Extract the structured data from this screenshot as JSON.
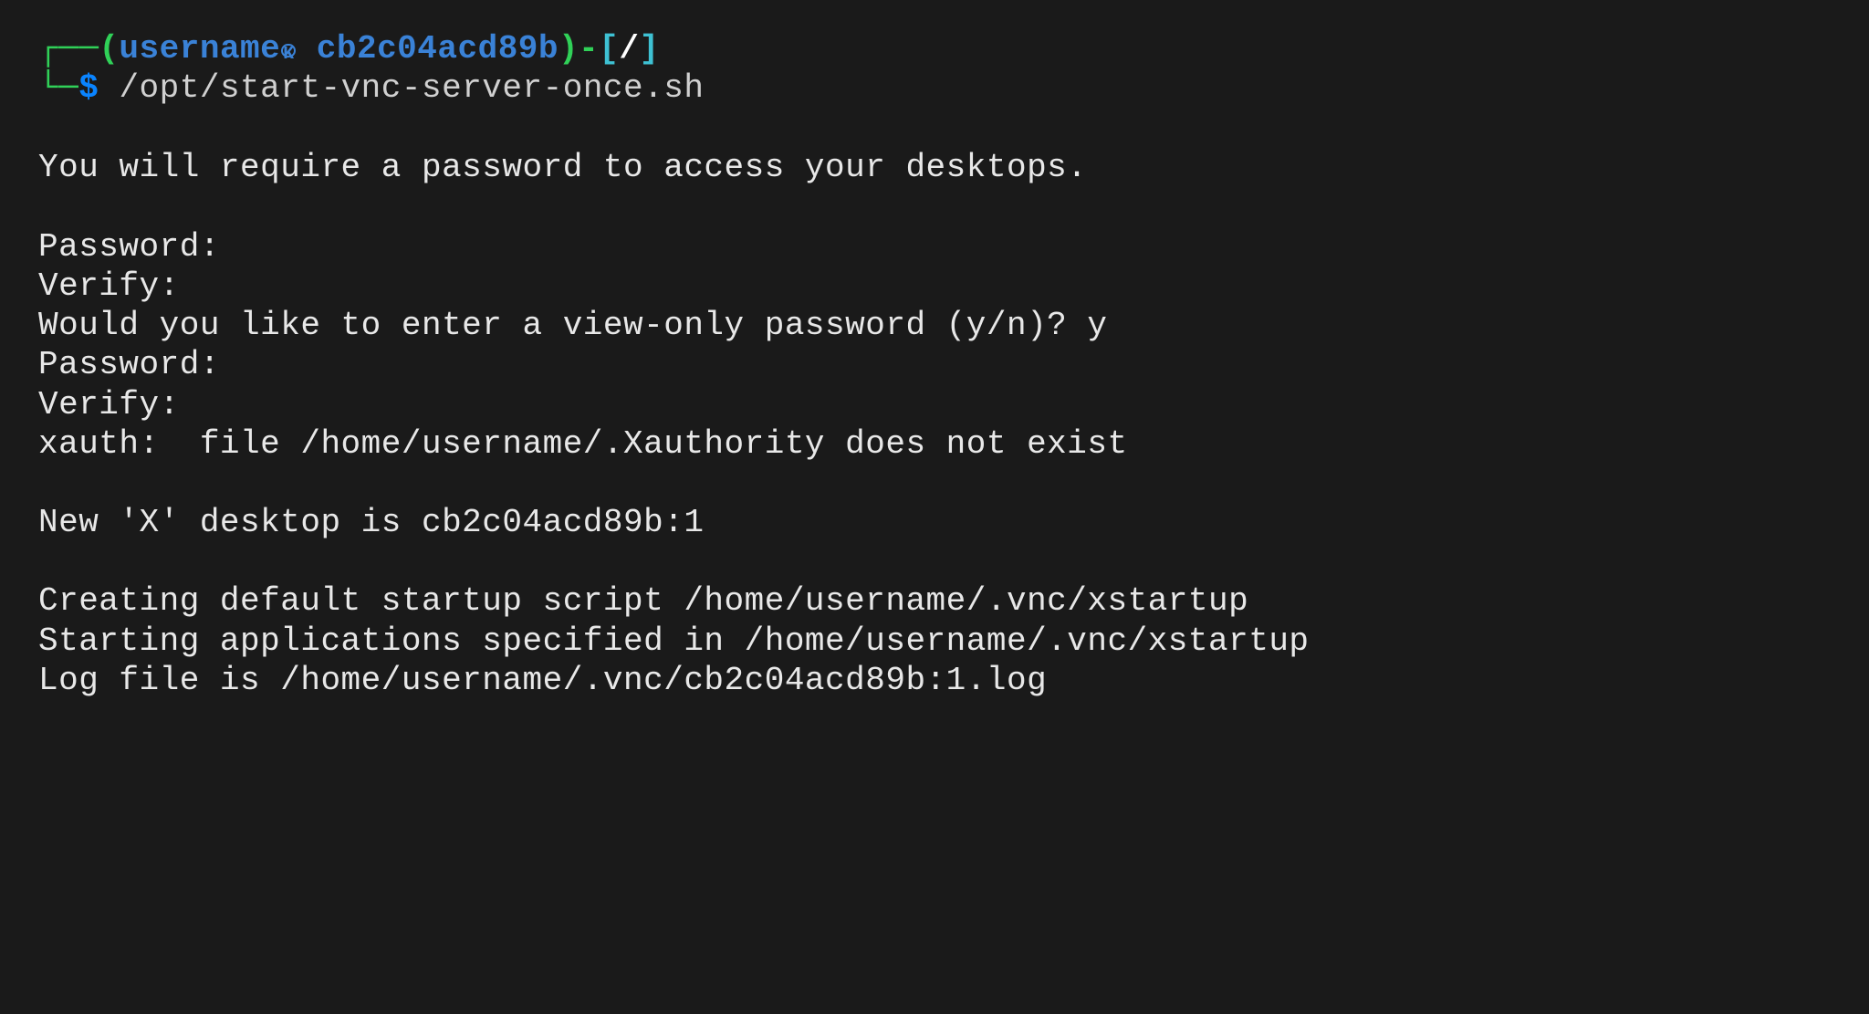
{
  "prompt": {
    "corner_tl": "┌──",
    "paren_open": "(",
    "username": "username",
    "host": "cb2c04acd89b",
    "paren_close": ")",
    "dash": "-",
    "bracket_open": "[",
    "cwd": "/",
    "bracket_close": "]",
    "corner_bl": "└─",
    "dollar": "$",
    "command": "/opt/start-vnc-server-once.sh"
  },
  "output": {
    "l0": "",
    "l1": "You will require a password to access your desktops.",
    "l2": "",
    "l3": "Password:",
    "l4": "Verify:",
    "l5": "Would you like to enter a view-only password (y/n)? y",
    "l6": "Password:",
    "l7": "Verify:",
    "l8": "xauth:  file /home/username/.Xauthority does not exist",
    "l9": "",
    "l10": "New 'X' desktop is cb2c04acd89b:1",
    "l11": "",
    "l12": "Creating default startup script /home/username/.vnc/xstartup",
    "l13": "Starting applications specified in /home/username/.vnc/xstartup",
    "l14": "Log file is /home/username/.vnc/cb2c04acd89b:1.log"
  }
}
